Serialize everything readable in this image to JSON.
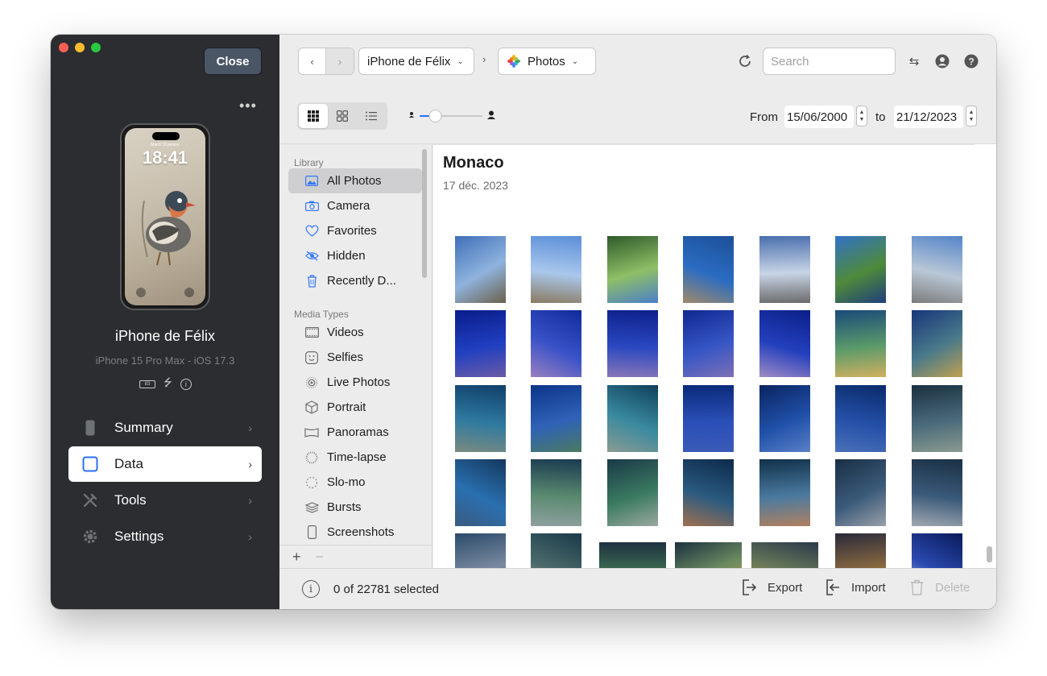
{
  "window": {
    "close_label": "Close",
    "more_label": "•••"
  },
  "device": {
    "lock_date": "Mardi 19 janvier",
    "lock_time": "18:41",
    "name": "iPhone de Félix",
    "model": "iPhone 15 Pro Max - iOS 17.3",
    "battery_label": "83"
  },
  "nav": {
    "items": [
      {
        "label": "Summary",
        "icon": "phone-icon"
      },
      {
        "label": "Data",
        "icon": "square-icon"
      },
      {
        "label": "Tools",
        "icon": "tools-icon"
      },
      {
        "label": "Settings",
        "icon": "gear-icon"
      }
    ],
    "active": "Data"
  },
  "toolbar": {
    "device_label": "iPhone de Félix",
    "app_label": "Photos",
    "search_placeholder": "Search",
    "from_label": "From",
    "from_date": "15/06/2000",
    "to_label": "to",
    "to_date": "21/12/2023",
    "zoom_level": 0.25
  },
  "library": {
    "sections": [
      {
        "title": "Library",
        "items": [
          {
            "label": "All Photos",
            "icon": "photos-icon"
          },
          {
            "label": "Camera",
            "icon": "camera-icon"
          },
          {
            "label": "Favorites",
            "icon": "heart-icon"
          },
          {
            "label": "Hidden",
            "icon": "eye-slash-icon"
          },
          {
            "label": "Recently D...",
            "icon": "trash-icon"
          }
        ]
      },
      {
        "title": "Media Types",
        "items": [
          {
            "label": "Videos",
            "icon": "film-icon"
          },
          {
            "label": "Selfies",
            "icon": "selfie-icon"
          },
          {
            "label": "Live Photos",
            "icon": "live-icon"
          },
          {
            "label": "Portrait",
            "icon": "cube-icon"
          },
          {
            "label": "Panoramas",
            "icon": "panorama-icon"
          },
          {
            "label": "Time-lapse",
            "icon": "timelapse-icon"
          },
          {
            "label": "Slo-mo",
            "icon": "slomo-icon"
          },
          {
            "label": "Bursts",
            "icon": "stack-icon"
          },
          {
            "label": "Screenshots",
            "icon": "screenshot-icon"
          }
        ]
      }
    ],
    "selected": "All Photos"
  },
  "grid": {
    "album_title": "Monaco",
    "album_date": "17 déc. 2023"
  },
  "bottom": {
    "selection": "0 of 22781 selected",
    "export_label": "Export",
    "import_label": "Import",
    "delete_label": "Delete"
  },
  "colors": {
    "sidebar_bg": "#2b2d30",
    "accent": "#2a6ff0",
    "traffic_red": "#fe5f57",
    "traffic_yellow": "#febc2e",
    "traffic_green": "#28c840"
  }
}
